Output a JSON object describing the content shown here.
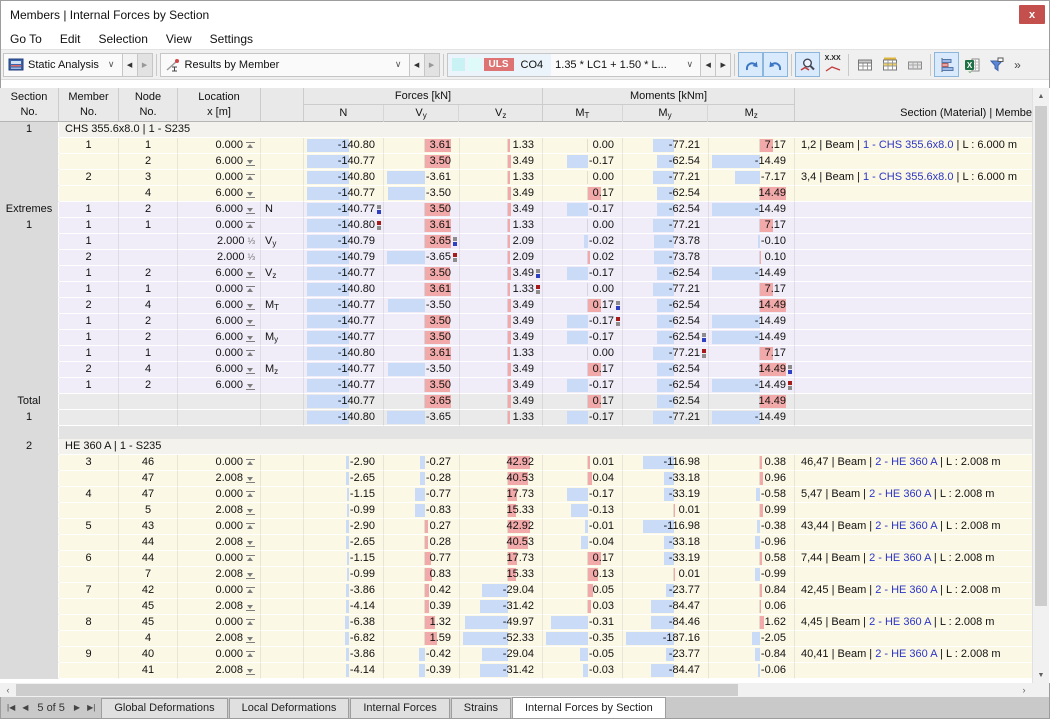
{
  "window": {
    "title": "Members | Internal Forces by Section",
    "close_label": "x"
  },
  "menu": [
    "Go To",
    "Edit",
    "Selection",
    "View",
    "Settings"
  ],
  "toolbar": {
    "analysis": {
      "label": "Static Analysis"
    },
    "results": {
      "label": "Results by Member"
    },
    "combo": {
      "badge": "ULS",
      "code": "CO4",
      "label": "1.35 * LC1 + 1.50 * L...",
      "legend_colors": [
        "#c9f2f4",
        "#defaf9"
      ],
      "badge_color": "#dd7373"
    },
    "xxx_label": "X.XX",
    "overflow": "»"
  },
  "header": {
    "section": [
      "Section",
      "No."
    ],
    "member": [
      "Member",
      "No."
    ],
    "node": [
      "Node",
      "No."
    ],
    "location": [
      "Location",
      "x [m]"
    ],
    "forces": {
      "group": "Forces [kN]",
      "cols": [
        "N",
        "Vy",
        "Vz"
      ]
    },
    "moments": {
      "group": "Moments [kNm]",
      "cols": [
        "MT",
        "My",
        "Mz"
      ]
    },
    "section_material": "Section (Material) | Membe"
  },
  "colors": {
    "pos_bar": "#f2a9a9",
    "neg_bar": "#c9dbf6",
    "max_marker": "#2f3fc2",
    "min_marker": "#a61a1a",
    "marker_gray": "#8c8c8c",
    "link_blue": "#2b35c4"
  },
  "rows": [
    {
      "t": "g",
      "sec": "1",
      "label": "CHS 355.6x8.0 | 1 - S235"
    },
    {
      "t": "d",
      "bg": "y",
      "m": "1",
      "n": "1",
      "x": "0.000",
      "xi": "s",
      "ext": "",
      "v": [
        "-140.80",
        "3.61",
        "1.33",
        "0.00",
        "-77.21",
        "7.17"
      ],
      "sect": [
        "1,2 | Beam | ",
        "1 - CHS 355.6x8.0",
        " | L : 6.000 m"
      ]
    },
    {
      "t": "d",
      "bg": "y",
      "m": "",
      "n": "2",
      "x": "6.000",
      "xi": "e",
      "ext": "",
      "v": [
        "-140.77",
        "3.50",
        "3.49",
        "-0.17",
        "-62.54",
        "-14.49"
      ]
    },
    {
      "t": "d",
      "bg": "y",
      "m": "2",
      "n": "3",
      "x": "0.000",
      "xi": "s",
      "ext": "",
      "v": [
        "-140.80",
        "-3.61",
        "1.33",
        "0.00",
        "-77.21",
        "-7.17"
      ],
      "sect": [
        "3,4 | Beam | ",
        "1 - CHS 355.6x8.0",
        " | L : 6.000 m"
      ]
    },
    {
      "t": "d",
      "bg": "y",
      "m": "",
      "n": "4",
      "x": "6.000",
      "xi": "e",
      "ext": "",
      "v": [
        "-140.77",
        "-3.50",
        "3.49",
        "0.17",
        "-62.54",
        "14.49"
      ]
    },
    {
      "t": "d",
      "bg": "e",
      "sec": "Extremes",
      "m": "1",
      "n": "2",
      "x": "6.000",
      "xi": "e",
      "ext": "N",
      "v": [
        "-140.77",
        "3.50",
        "3.49",
        "-0.17",
        "-62.54",
        "-14.49"
      ],
      "mk": [
        0,
        "max"
      ]
    },
    {
      "t": "d",
      "bg": "e",
      "sec": "1",
      "m": "1",
      "n": "1",
      "x": "0.000",
      "xi": "s",
      "ext": "",
      "v": [
        "-140.80",
        "3.61",
        "1.33",
        "0.00",
        "-77.21",
        "7.17"
      ],
      "mk": [
        0,
        "min"
      ]
    },
    {
      "t": "d",
      "bg": "e",
      "m": "1",
      "n": "",
      "x": "2.000",
      "xi": "f",
      "ext": "Vy",
      "v": [
        "-140.79",
        "3.65",
        "2.09",
        "-0.02",
        "-73.78",
        "-0.10"
      ],
      "mk": [
        1,
        "max"
      ]
    },
    {
      "t": "d",
      "bg": "e",
      "m": "2",
      "n": "",
      "x": "2.000",
      "xi": "f",
      "ext": "",
      "v": [
        "-140.79",
        "-3.65",
        "2.09",
        "0.02",
        "-73.78",
        "0.10"
      ],
      "mk": [
        1,
        "min"
      ]
    },
    {
      "t": "d",
      "bg": "e",
      "m": "1",
      "n": "2",
      "x": "6.000",
      "xi": "e",
      "ext": "Vz",
      "v": [
        "-140.77",
        "3.50",
        "3.49",
        "-0.17",
        "-62.54",
        "-14.49"
      ],
      "mk": [
        2,
        "max"
      ]
    },
    {
      "t": "d",
      "bg": "e",
      "m": "1",
      "n": "1",
      "x": "0.000",
      "xi": "s",
      "ext": "",
      "v": [
        "-140.80",
        "3.61",
        "1.33",
        "0.00",
        "-77.21",
        "7.17"
      ],
      "mk": [
        2,
        "min"
      ]
    },
    {
      "t": "d",
      "bg": "e",
      "m": "2",
      "n": "4",
      "x": "6.000",
      "xi": "e",
      "ext": "MT",
      "v": [
        "-140.77",
        "-3.50",
        "3.49",
        "0.17",
        "-62.54",
        "14.49"
      ],
      "mk": [
        3,
        "max"
      ]
    },
    {
      "t": "d",
      "bg": "e",
      "m": "1",
      "n": "2",
      "x": "6.000",
      "xi": "e",
      "ext": "",
      "v": [
        "-140.77",
        "3.50",
        "3.49",
        "-0.17",
        "-62.54",
        "-14.49"
      ],
      "mk": [
        3,
        "min"
      ]
    },
    {
      "t": "d",
      "bg": "e",
      "m": "1",
      "n": "2",
      "x": "6.000",
      "xi": "e",
      "ext": "My",
      "v": [
        "-140.77",
        "3.50",
        "3.49",
        "-0.17",
        "-62.54",
        "-14.49"
      ],
      "mk": [
        4,
        "max"
      ]
    },
    {
      "t": "d",
      "bg": "e",
      "m": "1",
      "n": "1",
      "x": "0.000",
      "xi": "s",
      "ext": "",
      "v": [
        "-140.80",
        "3.61",
        "1.33",
        "0.00",
        "-77.21",
        "7.17"
      ],
      "mk": [
        4,
        "min"
      ]
    },
    {
      "t": "d",
      "bg": "e",
      "m": "2",
      "n": "4",
      "x": "6.000",
      "xi": "e",
      "ext": "Mz",
      "v": [
        "-140.77",
        "-3.50",
        "3.49",
        "0.17",
        "-62.54",
        "14.49"
      ],
      "mk": [
        5,
        "max"
      ]
    },
    {
      "t": "d",
      "bg": "e",
      "m": "1",
      "n": "2",
      "x": "6.000",
      "xi": "e",
      "ext": "",
      "v": [
        "-140.77",
        "3.50",
        "3.49",
        "-0.17",
        "-62.54",
        "-14.49"
      ],
      "mk": [
        5,
        "min"
      ]
    },
    {
      "t": "d",
      "bg": "t",
      "sec": "Total",
      "m": "",
      "n": "",
      "x": "",
      "xi": "",
      "ext": "",
      "v": [
        "-140.77",
        "3.65",
        "3.49",
        "0.17",
        "-62.54",
        "14.49"
      ]
    },
    {
      "t": "d",
      "bg": "t",
      "sec": "1",
      "m": "",
      "n": "",
      "x": "",
      "xi": "",
      "ext": "",
      "v": [
        "-140.80",
        "-3.65",
        "1.33",
        "-0.17",
        "-77.21",
        "-14.49"
      ]
    },
    {
      "t": "sp"
    },
    {
      "t": "g",
      "sec": "2",
      "label": "HE 360 A | 1 - S235"
    },
    {
      "t": "d",
      "bg": "y",
      "m": "3",
      "n": "46",
      "x": "0.000",
      "xi": "s",
      "ext": "",
      "v": [
        "-2.90",
        "-0.27",
        "42.92",
        "0.01",
        "-116.98",
        "0.38"
      ],
      "sect": [
        "46,47 | Beam | ",
        "2 - HE 360 A",
        " | L : 2.008 m"
      ]
    },
    {
      "t": "d",
      "bg": "y",
      "m": "",
      "n": "47",
      "x": "2.008",
      "xi": "e",
      "ext": "",
      "v": [
        "-2.65",
        "-0.28",
        "40.53",
        "0.04",
        "-33.18",
        "0.96"
      ]
    },
    {
      "t": "d",
      "bg": "y",
      "m": "4",
      "n": "47",
      "x": "0.000",
      "xi": "s",
      "ext": "",
      "v": [
        "-1.15",
        "-0.77",
        "17.73",
        "-0.17",
        "-33.19",
        "-0.58"
      ],
      "sect": [
        "5,47 | Beam | ",
        "2 - HE 360 A",
        " | L : 2.008 m"
      ]
    },
    {
      "t": "d",
      "bg": "y",
      "m": "",
      "n": "5",
      "x": "2.008",
      "xi": "e",
      "ext": "",
      "v": [
        "-0.99",
        "-0.83",
        "15.33",
        "-0.13",
        "0.01",
        "0.99"
      ]
    },
    {
      "t": "d",
      "bg": "y",
      "m": "5",
      "n": "43",
      "x": "0.000",
      "xi": "s",
      "ext": "",
      "v": [
        "-2.90",
        "0.27",
        "42.92",
        "-0.01",
        "-116.98",
        "-0.38"
      ],
      "sect": [
        "43,44 | Beam | ",
        "2 - HE 360 A",
        " | L : 2.008 m"
      ]
    },
    {
      "t": "d",
      "bg": "y",
      "m": "",
      "n": "44",
      "x": "2.008",
      "xi": "e",
      "ext": "",
      "v": [
        "-2.65",
        "0.28",
        "40.53",
        "-0.04",
        "-33.18",
        "-0.96"
      ]
    },
    {
      "t": "d",
      "bg": "y",
      "m": "6",
      "n": "44",
      "x": "0.000",
      "xi": "s",
      "ext": "",
      "v": [
        "-1.15",
        "0.77",
        "17.73",
        "0.17",
        "-33.19",
        "0.58"
      ],
      "sect": [
        "7,44 | Beam | ",
        "2 - HE 360 A",
        " | L : 2.008 m"
      ]
    },
    {
      "t": "d",
      "bg": "y",
      "m": "",
      "n": "7",
      "x": "2.008",
      "xi": "e",
      "ext": "",
      "v": [
        "-0.99",
        "0.83",
        "15.33",
        "0.13",
        "0.01",
        "-0.99"
      ]
    },
    {
      "t": "d",
      "bg": "y",
      "m": "7",
      "n": "42",
      "x": "0.000",
      "xi": "s",
      "ext": "",
      "v": [
        "-3.86",
        "0.42",
        "-29.04",
        "0.05",
        "-23.77",
        "0.84"
      ],
      "sect": [
        "42,45 | Beam | ",
        "2 - HE 360 A",
        " | L : 2.008 m"
      ]
    },
    {
      "t": "d",
      "bg": "y",
      "m": "",
      "n": "45",
      "x": "2.008",
      "xi": "e",
      "ext": "",
      "v": [
        "-4.14",
        "0.39",
        "-31.42",
        "0.03",
        "-84.47",
        "0.06"
      ]
    },
    {
      "t": "d",
      "bg": "y",
      "m": "8",
      "n": "45",
      "x": "0.000",
      "xi": "s",
      "ext": "",
      "v": [
        "-6.38",
        "1.32",
        "-49.97",
        "-0.31",
        "-84.46",
        "1.62"
      ],
      "sect": [
        "4,45 | Beam | ",
        "2 - HE 360 A",
        " | L : 2.008 m"
      ]
    },
    {
      "t": "d",
      "bg": "y",
      "m": "",
      "n": "4",
      "x": "2.008",
      "xi": "e",
      "ext": "",
      "v": [
        "-6.82",
        "1.59",
        "-52.33",
        "-0.35",
        "-187.16",
        "-2.05"
      ]
    },
    {
      "t": "d",
      "bg": "y",
      "m": "9",
      "n": "40",
      "x": "0.000",
      "xi": "s",
      "ext": "",
      "v": [
        "-3.86",
        "-0.42",
        "-29.04",
        "-0.05",
        "-23.77",
        "-0.84"
      ],
      "sect": [
        "40,41 | Beam | ",
        "2 - HE 360 A",
        " | L : 2.008 m"
      ]
    },
    {
      "t": "d",
      "bg": "y",
      "m": "",
      "n": "41",
      "x": "2.008",
      "xi": "e",
      "ext": "",
      "v": [
        "-4.14",
        "-0.39",
        "-31.42",
        "-0.03",
        "-84.47",
        "-0.06"
      ]
    }
  ],
  "footer": {
    "pager": "5 of 5",
    "tabs": [
      {
        "label": "Global Deformations",
        "active": false
      },
      {
        "label": "Local Deformations",
        "active": false
      },
      {
        "label": "Internal Forces",
        "active": false
      },
      {
        "label": "Strains",
        "active": false
      },
      {
        "label": "Internal Forces by Section",
        "active": true
      }
    ]
  }
}
